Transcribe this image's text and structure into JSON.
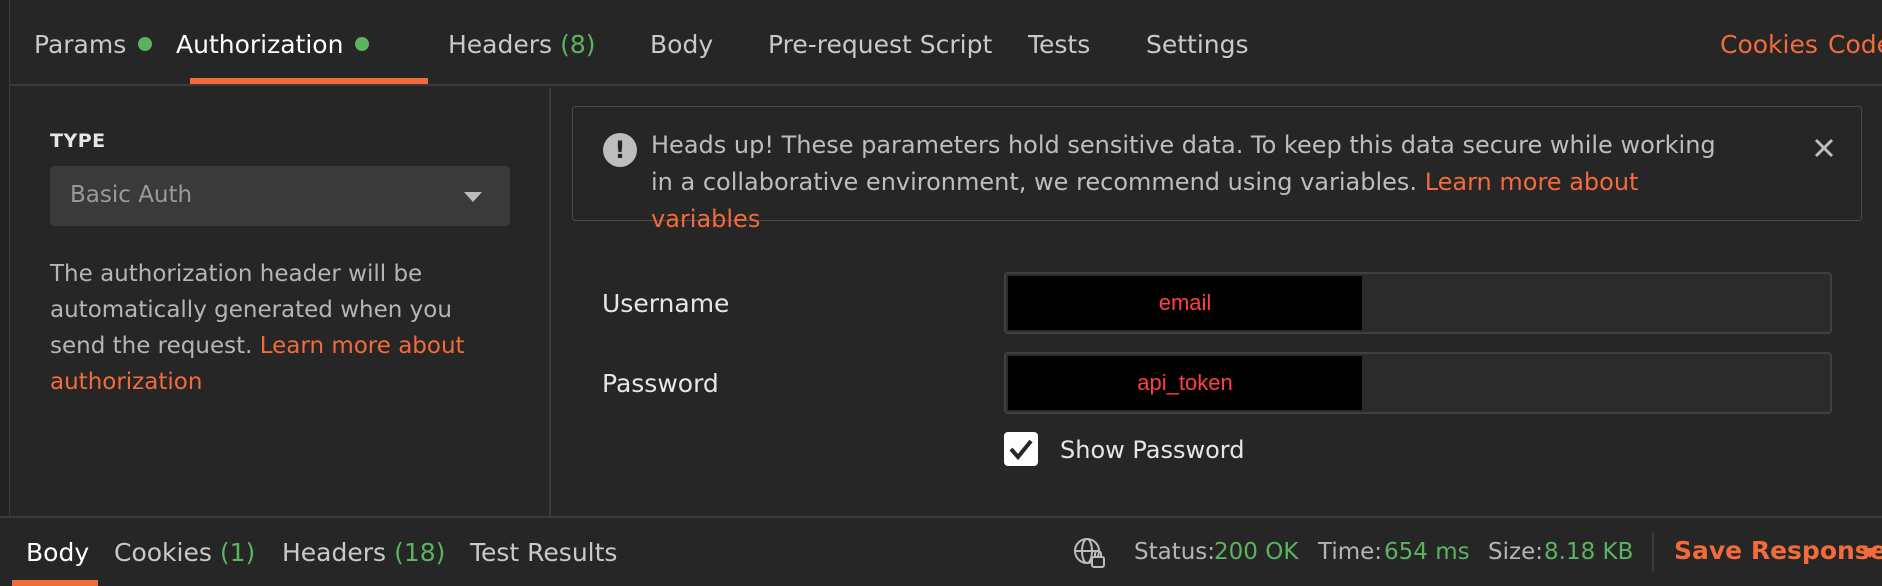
{
  "tabs": [
    {
      "label": "Params",
      "dot": true
    },
    {
      "label": "Authorization",
      "dot": true
    },
    {
      "label": "Headers",
      "count": "(8)"
    },
    {
      "label": "Body"
    },
    {
      "label": "Pre-request Script"
    },
    {
      "label": "Tests"
    },
    {
      "label": "Settings"
    }
  ],
  "tab_links": {
    "cookies": "Cookies",
    "code": "Code"
  },
  "auth": {
    "type_label": "TYPE",
    "type_value": "Basic Auth",
    "help_text": "The authorization header will be automatically generated when you send the request. ",
    "help_link": "Learn more about authorization"
  },
  "alert": {
    "text": "Heads up! These parameters hold sensitive data. To keep this data secure while working in a collaborative environment, we recommend using variables. ",
    "link": "Learn more about variables"
  },
  "fields": {
    "username_label": "Username",
    "username_value": "email",
    "password_label": "Password",
    "password_value": "api_token",
    "show_password_label": "Show Password",
    "show_password_checked": true
  },
  "bottom": {
    "tabs": [
      {
        "label": "Body"
      },
      {
        "label": "Cookies",
        "count": "(1)"
      },
      {
        "label": "Headers",
        "count": "(18)"
      },
      {
        "label": "Test Results"
      }
    ],
    "status_label": "Status:",
    "status_value": "200 OK",
    "time_label": "Time:",
    "time_value": "654 ms",
    "size_label": "Size:",
    "size_value": "8.18 KB",
    "save_label": "Save Response"
  },
  "colors": {
    "accent": "#f26b3a",
    "success": "#5bb35f",
    "background": "#262626"
  }
}
